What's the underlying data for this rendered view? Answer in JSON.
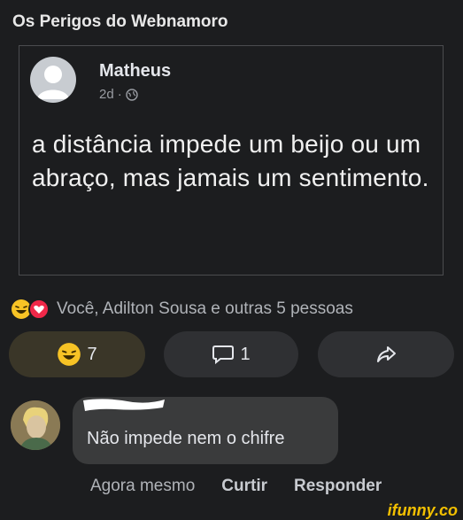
{
  "group": {
    "title": "Os Perigos do Webnamoro"
  },
  "post": {
    "author": "Matheus",
    "time": "2d",
    "text": "a distância impede um beijo ou um abraço, mas jamais um sentimento."
  },
  "reactions": {
    "summary": "Você, Adilton Sousa e outras 5 pessoas",
    "haha_count": "7",
    "comment_count": "1"
  },
  "comment": {
    "text": "Não impede nem o chifre",
    "time": "Agora mesmo",
    "like_label": "Curtir",
    "reply_label": "Responder"
  },
  "watermark": "ifunny.co",
  "colors": {
    "haha": "#f7c325",
    "love": "#f02849",
    "background": "#1c1d1f"
  }
}
